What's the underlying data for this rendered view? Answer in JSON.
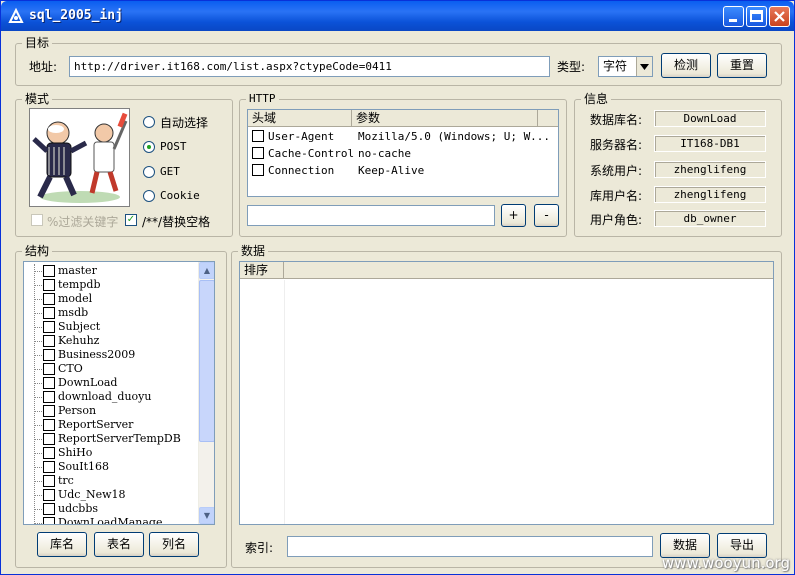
{
  "window": {
    "title": "sql_2005_inj",
    "minimize": "_",
    "maximize": "□",
    "close": "✕",
    "icon": "app-icon"
  },
  "target": {
    "legend": "目标",
    "address_label": "地址:",
    "address_value": "http://driver.it168.com/list.aspx?ctypeCode=0411",
    "type_label": "类型:",
    "type_value": "字符",
    "detect_button": "检测",
    "reset_button": "重置"
  },
  "mode": {
    "legend": "模式",
    "options": [
      {
        "label": "自动选择",
        "selected": false
      },
      {
        "label": "POST",
        "selected": true
      },
      {
        "label": "GET",
        "selected": false
      },
      {
        "label": "Cookie",
        "selected": false
      }
    ],
    "filter_keyword": {
      "label": "%过滤关键字",
      "checked": false,
      "disabled": true
    },
    "replace_space": {
      "label": "/**/替换空格",
      "checked": true
    }
  },
  "http": {
    "legend": "HTTP",
    "columns": [
      "头域",
      "参数"
    ],
    "rows": [
      {
        "header": "User-Agent",
        "value": "Mozilla/5.0 (Windows; U; W..."
      },
      {
        "header": "Cache-Control",
        "value": "no-cache"
      },
      {
        "header": "Connection",
        "value": "Keep-Alive"
      }
    ],
    "input_value": "",
    "add_button": "+",
    "remove_button": "-"
  },
  "info": {
    "legend": "信息",
    "fields": [
      {
        "label": "数据库名:",
        "value": "DownLoad"
      },
      {
        "label": "服务器名:",
        "value": "IT168-DB1"
      },
      {
        "label": "系统用户:",
        "value": "zhenglifeng"
      },
      {
        "label": "库用户名:",
        "value": "zhenglifeng"
      },
      {
        "label": "用户角色:",
        "value": "db_owner"
      }
    ]
  },
  "structure": {
    "legend": "结构",
    "databases": [
      "master",
      "tempdb",
      "model",
      "msdb",
      "Subject",
      "Kehuhz",
      "Business2009",
      "CTO",
      "DownLoad",
      "download_duoyu",
      "Person",
      "ReportServer",
      "ReportServerTempDB",
      "ShiHo",
      "SouIt168",
      "trc",
      "Udc_New18",
      "udcbbs",
      "DownLoadManage"
    ],
    "db_button": "库名",
    "table_button": "表名",
    "column_button": "列名"
  },
  "data_panel": {
    "legend": "数据",
    "columns": [
      "排序"
    ],
    "index_label": "索引:",
    "index_value": "",
    "data_button": "数据",
    "export_button": "导出"
  },
  "watermark": "www.wooyun.org"
}
